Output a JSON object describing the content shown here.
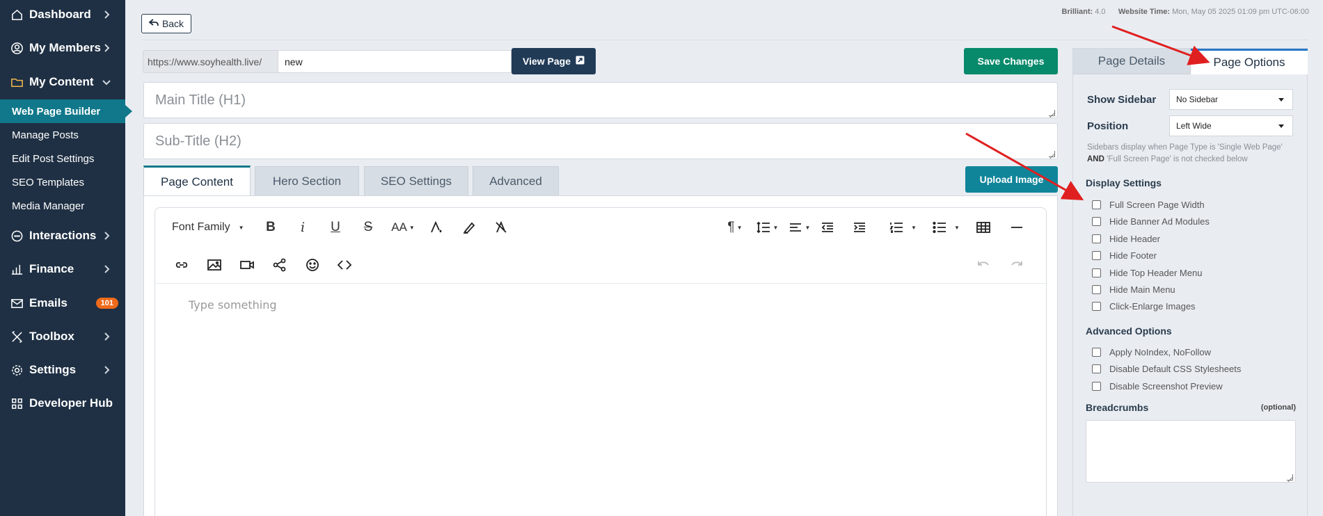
{
  "sidebar": {
    "items": [
      {
        "label": "Dashboard",
        "icon": "home-icon"
      },
      {
        "label": "My Members",
        "icon": "user-circle-icon"
      },
      {
        "label": "My Content",
        "icon": "folder-icon"
      },
      {
        "label": "Interactions",
        "icon": "chat-bubble-icon"
      },
      {
        "label": "Finance",
        "icon": "bar-chart-icon"
      },
      {
        "label": "Emails",
        "icon": "envelope-icon",
        "badge": "101"
      },
      {
        "label": "Toolbox",
        "icon": "tools-icon"
      },
      {
        "label": "Settings",
        "icon": "gear-icon"
      },
      {
        "label": "Developer Hub",
        "icon": "grid-icon"
      }
    ],
    "submenu": [
      "Web Page Builder",
      "Manage Posts",
      "Edit Post Settings",
      "SEO Templates",
      "Media Manager"
    ]
  },
  "header": {
    "back_label": "Back",
    "brilliant_label": "Brilliant:",
    "brilliant_version": "4.0",
    "website_time_label": "Website Time:",
    "website_time_value": "Mon, May 05 2025 01:09 pm UTC-06:00"
  },
  "url": {
    "prefix": "https://www.soyhealth.live/",
    "slug": "new",
    "view_label": "View Page",
    "save_label": "Save Changes"
  },
  "fields": {
    "main_title_placeholder": "Main Title (H1)",
    "subtitle_placeholder": "Sub-Title (H2)"
  },
  "tabs": [
    "Page Content",
    "Hero Section",
    "SEO Settings",
    "Advanced"
  ],
  "upload_label": "Upload Image",
  "editor": {
    "font_family_label": "Font Family",
    "placeholder": "Type something"
  },
  "right_panel": {
    "tabs": [
      "Page Details",
      "Page Options"
    ],
    "show_sidebar_label": "Show Sidebar",
    "show_sidebar_value": "No Sidebar",
    "position_label": "Position",
    "position_value": "Left Wide",
    "note_part1": "Sidebars display when Page Type is 'Single Web Page'",
    "note_and": "AND",
    "note_part2": "'Full Screen Page' is not checked below",
    "display_settings_title": "Display Settings",
    "display_options": [
      "Full Screen Page Width",
      "Hide Banner Ad Modules",
      "Hide Header",
      "Hide Footer",
      "Hide Top Header Menu",
      "Hide Main Menu",
      "Click-Enlarge Images"
    ],
    "advanced_title": "Advanced Options",
    "advanced_options": [
      "Apply NoIndex, NoFollow",
      "Disable Default CSS Stylesheets",
      "Disable Screenshot Preview"
    ],
    "breadcrumbs_label": "Breadcrumbs",
    "optional_label": "(optional)"
  },
  "colors": {
    "sidebar_bg": "#1f3044",
    "active_teal": "#10788a",
    "save_green": "#078a6b",
    "view_navy": "#213b57",
    "badge_orange": "#ef6a1a",
    "annotation_red": "#e02020"
  }
}
